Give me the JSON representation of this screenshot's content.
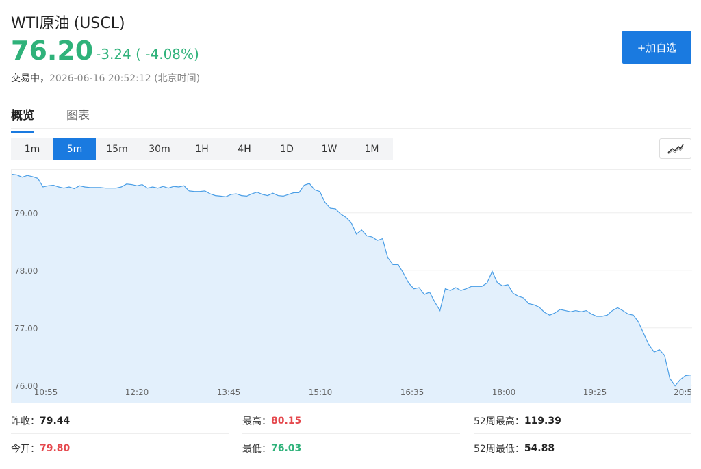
{
  "header": {
    "name": "WTI原油",
    "code": "(USCL)",
    "price": "76.20",
    "change": "-3.24 ( -4.08%)",
    "status": "交易中，",
    "timestamp": "2026-06-16 20:52:12 (北京时间)",
    "add_button": "+加自选"
  },
  "tabs": [
    "概览",
    "图表"
  ],
  "periods": [
    "1m",
    "5m",
    "15m",
    "30m",
    "1H",
    "4H",
    "1D",
    "1W",
    "1M"
  ],
  "active_period": "5m",
  "colors": {
    "up": "#e5484d",
    "down": "#2fb27a",
    "accent": "#1a7ae0",
    "line": "#4a9ee6",
    "fill": "#e3f0fc"
  },
  "chart_data": {
    "type": "area",
    "x_ticks": [
      "10:55",
      "12:20",
      "13:45",
      "15:10",
      "16:35",
      "18:00",
      "19:25",
      "20:5"
    ],
    "y_ticks": [
      "76.00",
      "77.00",
      "78.00",
      "79.00"
    ],
    "ylim": [
      75.95,
      79.7
    ],
    "grid": true,
    "x_start": "10:50",
    "x_end": "20:55",
    "series": [
      {
        "name": "",
        "values": [
          79.67,
          79.66,
          79.62,
          79.65,
          79.63,
          79.6,
          79.45,
          79.47,
          79.48,
          79.45,
          79.43,
          79.45,
          79.42,
          79.47,
          79.45,
          79.44,
          79.44,
          79.44,
          79.43,
          79.43,
          79.43,
          79.45,
          79.5,
          79.49,
          79.47,
          79.49,
          79.43,
          79.45,
          79.43,
          79.46,
          79.43,
          79.46,
          79.45,
          79.47,
          79.38,
          79.37,
          79.37,
          79.38,
          79.33,
          79.3,
          79.29,
          79.28,
          79.32,
          79.33,
          79.3,
          79.29,
          79.33,
          79.36,
          79.32,
          79.3,
          79.34,
          79.3,
          79.29,
          79.32,
          79.35,
          79.35,
          79.48,
          79.51,
          79.4,
          79.37,
          79.18,
          79.08,
          79.07,
          78.98,
          78.92,
          78.83,
          78.63,
          78.7,
          78.6,
          78.58,
          78.52,
          78.55,
          78.22,
          78.1,
          78.1,
          77.95,
          77.78,
          77.68,
          77.7,
          77.58,
          77.62,
          77.45,
          77.3,
          77.68,
          77.65,
          77.7,
          77.65,
          77.68,
          77.72,
          77.72,
          77.72,
          77.78,
          77.98,
          77.78,
          77.73,
          77.75,
          77.6,
          77.55,
          77.52,
          77.42,
          77.4,
          77.36,
          77.27,
          77.22,
          77.26,
          77.32,
          77.3,
          77.28,
          77.3,
          77.28,
          77.3,
          77.24,
          77.2,
          77.2,
          77.22,
          77.3,
          77.35,
          77.3,
          77.24,
          77.22,
          77.1,
          76.9,
          76.7,
          76.58,
          76.62,
          76.52,
          76.12,
          75.99,
          76.1,
          76.17,
          76.18
        ]
      }
    ]
  },
  "stats": {
    "prev_close_label": "昨收：",
    "prev_close": "79.44",
    "high_label": "最高：",
    "high": "80.15",
    "w52_high_label": "52周最高：",
    "w52_high": "119.39",
    "open_label": "今开：",
    "open": "79.80",
    "low_label": "最低：",
    "low": "76.03",
    "w52_low_label": "52周最低：",
    "w52_low": "54.88"
  }
}
